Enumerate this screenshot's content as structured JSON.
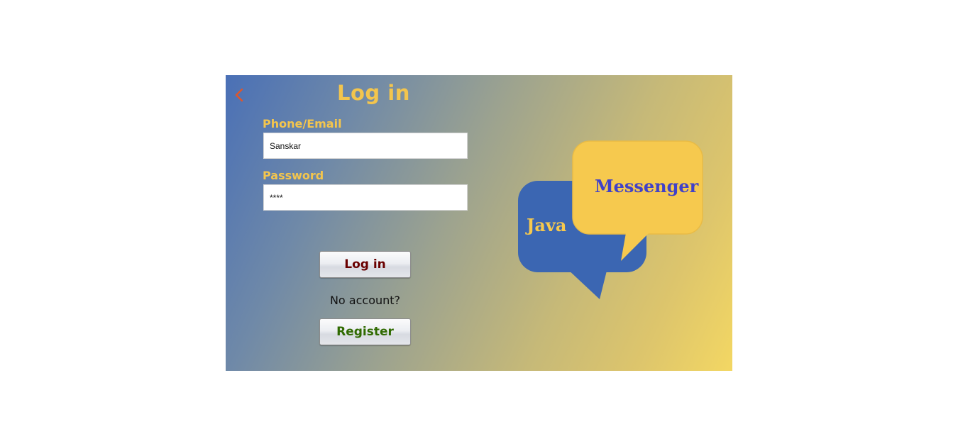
{
  "window": {
    "title": "Log in",
    "back_icon": "chevron-left-icon"
  },
  "form": {
    "phone_label": "Phone/Email",
    "phone_value": "Sanskar",
    "password_label": "Password",
    "password_value": "****"
  },
  "actions": {
    "login_label": "Log in",
    "no_account_text": "No account?",
    "register_label": "Register"
  },
  "logo": {
    "word_left": "Java",
    "word_right": "Messenger"
  },
  "colors": {
    "accent_yellow": "#f3c54d",
    "back_arrow": "#e0562a",
    "login_text": "#6a0000",
    "register_text": "#2f6a00",
    "bubble_blue": "#3b66b2",
    "bubble_yellow": "#f6c94e",
    "messenger_text": "#4141c8"
  }
}
